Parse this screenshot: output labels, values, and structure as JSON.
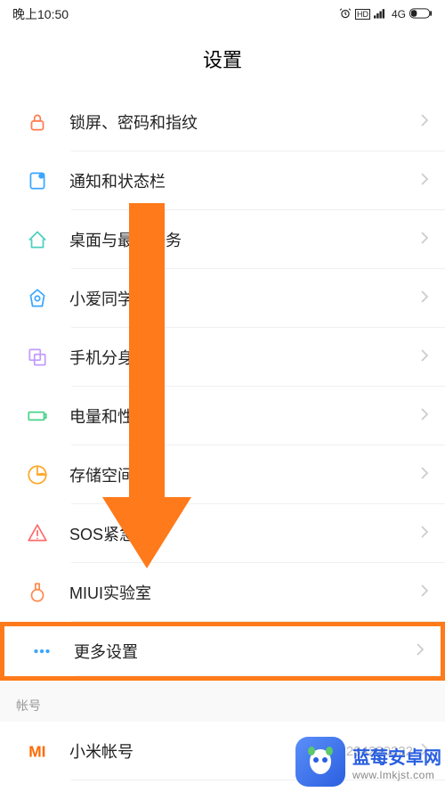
{
  "status": {
    "time": "晚上10:50",
    "network": "4G",
    "hd": "HD"
  },
  "page": {
    "title": "设置"
  },
  "items": [
    {
      "icon": "lock",
      "color": "#ff7a4f",
      "label": "锁屏、密码和指纹"
    },
    {
      "icon": "notification",
      "color": "#3aa6ff",
      "label": "通知和状态栏"
    },
    {
      "icon": "home",
      "color": "#4ccfbf",
      "label": "桌面与最近任务"
    },
    {
      "icon": "xiaoai",
      "color": "#3aa6ff",
      "label": "小爱同学"
    },
    {
      "icon": "clone",
      "color": "#c29bff",
      "label": "手机分身"
    },
    {
      "icon": "battery",
      "color": "#4cd28a",
      "label": "电量和性"
    },
    {
      "icon": "storage",
      "color": "#ffa726",
      "label": "存储空间"
    },
    {
      "icon": "sos",
      "color": "#ff6b6b",
      "label": "SOS紧急"
    },
    {
      "icon": "lab",
      "color": "#ff8a4f",
      "label": "MIUI实验室"
    },
    {
      "icon": "more",
      "color": "#3aa6ff",
      "label": "更多设置",
      "highlight": true
    }
  ],
  "section": {
    "header": "帐号",
    "items": [
      {
        "icon": "mi",
        "color": "#ff6a00",
        "label": "小米帐号",
        "value": "1284220222"
      }
    ]
  },
  "watermark": {
    "title": "蓝莓安卓网",
    "url": "www.lmkjst.com"
  }
}
